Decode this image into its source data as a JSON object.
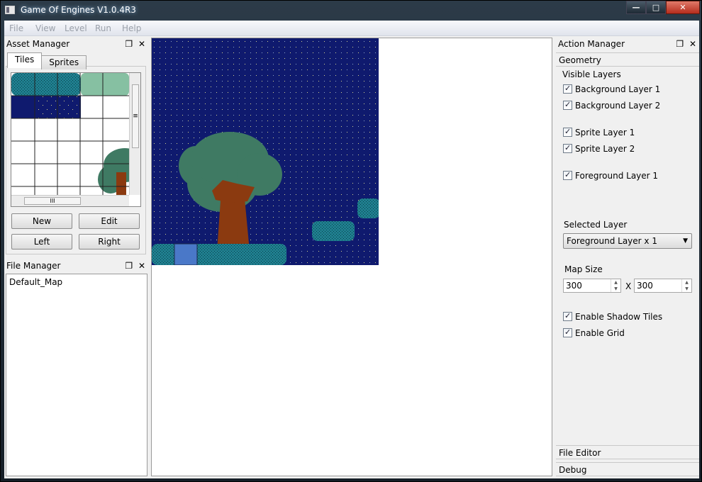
{
  "window": {
    "title": "Game Of Engines V1.0.4R3",
    "buttons": {
      "minimize": "—",
      "maximize": "□",
      "close": "✕"
    }
  },
  "menu": [
    "File",
    "View",
    "Level",
    "Run",
    "Help"
  ],
  "asset_manager": {
    "title": "Asset Manager",
    "tabs": [
      "Tiles",
      "Sprites"
    ],
    "active_tab": "Tiles",
    "buttons": {
      "new": "New",
      "edit": "Edit",
      "left": "Left",
      "right": "Right"
    },
    "scroll_h_grip": "III",
    "scroll_v_grip": "≡"
  },
  "file_manager": {
    "title": "File Manager",
    "items": [
      "Default_Map"
    ]
  },
  "dock_buttons": {
    "float": "❐",
    "close": "✕"
  },
  "action_manager": {
    "title": "Action Manager",
    "section": "Geometry",
    "visible_layers_label": "Visible Layers",
    "layers": [
      {
        "label": "Background Layer 1",
        "checked": true
      },
      {
        "label": "Background Layer 2",
        "checked": true
      },
      {
        "label": "Sprite Layer 1",
        "checked": true
      },
      {
        "label": "Sprite Layer 2",
        "checked": true
      },
      {
        "label": "Foreground Layer 1",
        "checked": true
      }
    ],
    "selected_layer_label": "Selected Layer",
    "selected_layer_value": "Foreground Layer x 1",
    "map_size_label": "Map Size",
    "map_width": "300",
    "map_height": "300",
    "map_size_sep": "X",
    "enable_shadow_tiles": {
      "label": "Enable Shadow Tiles",
      "checked": true
    },
    "enable_grid": {
      "label": "Enable Grid",
      "checked": true
    }
  },
  "bottom_sections": [
    "File Editor",
    "Debug"
  ],
  "colors": {
    "sky": "#0f1a6e",
    "star": "#d8d48a",
    "foliage": "#3f7a63",
    "trunk": "#8b3a10",
    "platform": "#1f7f8f",
    "blue_tile": "#4a78c8",
    "pale_tile": "#86c0a2"
  }
}
